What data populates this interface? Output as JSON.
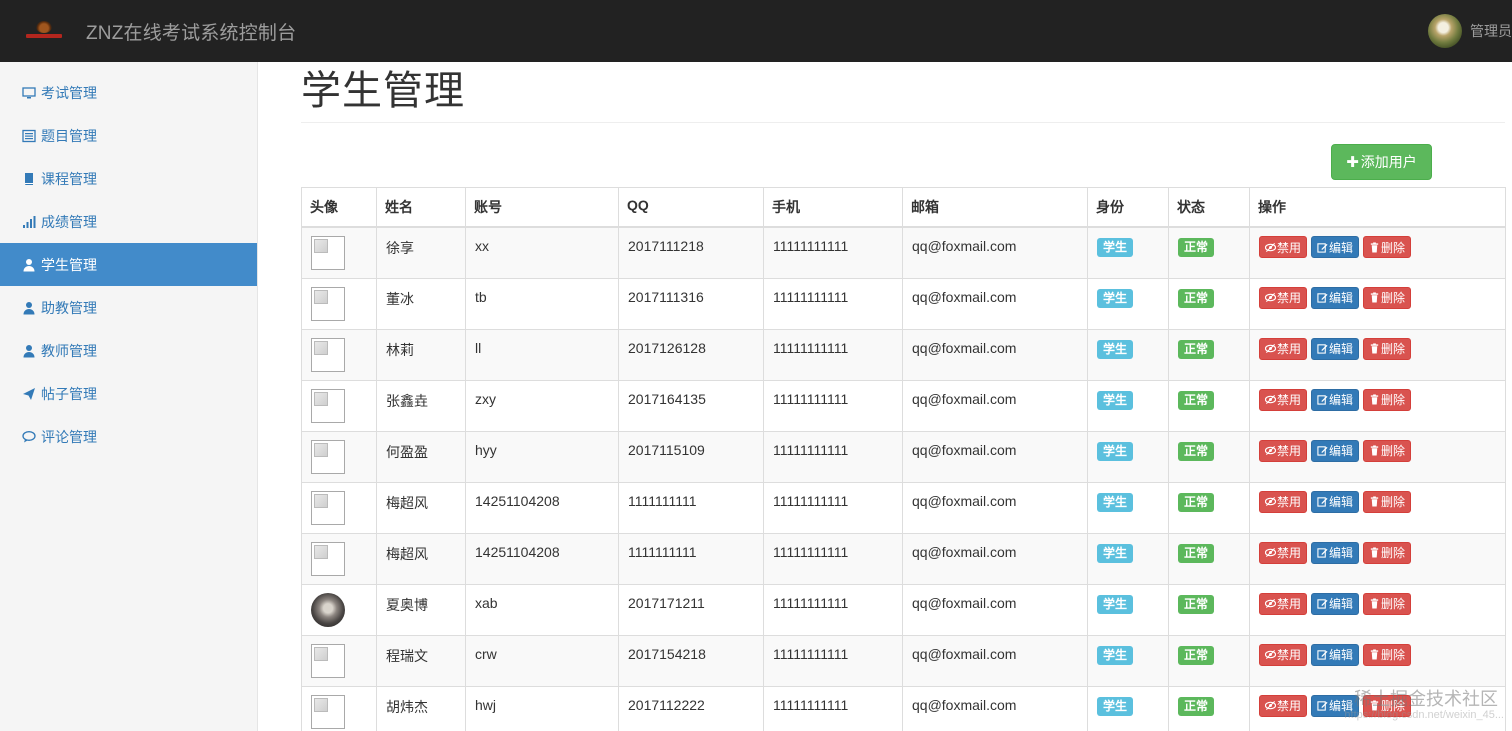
{
  "app": {
    "title": "ZNZ在线考试系统控制台",
    "user": "管理员"
  },
  "sidebar": {
    "items": [
      {
        "label": "考试管理",
        "icon": "monitor-icon"
      },
      {
        "label": "题目管理",
        "icon": "list-icon"
      },
      {
        "label": "课程管理",
        "icon": "book-icon"
      },
      {
        "label": "成绩管理",
        "icon": "signal-icon"
      },
      {
        "label": "学生管理",
        "icon": "user-icon",
        "active": true
      },
      {
        "label": "助教管理",
        "icon": "user-icon"
      },
      {
        "label": "教师管理",
        "icon": "user-icon"
      },
      {
        "label": "帖子管理",
        "icon": "send-icon"
      },
      {
        "label": "评论管理",
        "icon": "comment-icon"
      }
    ]
  },
  "page": {
    "title": "学生管理",
    "add_button": "添加用户"
  },
  "table": {
    "headers": [
      "头像",
      "姓名",
      "账号",
      "QQ",
      "手机",
      "邮箱",
      "身份",
      "状态",
      "操作"
    ],
    "actions": {
      "disable": "禁用",
      "edit": "编辑",
      "delete": "删除"
    },
    "rows": [
      {
        "avatar": "broken-image",
        "name": "徐享",
        "account": "xx",
        "qq": "2017111218",
        "phone": "11111111111",
        "email": "qq@foxmail.com",
        "role": "学生",
        "status": "正常"
      },
      {
        "avatar": "broken-image",
        "name": "董冰",
        "account": "tb",
        "qq": "2017111316",
        "phone": "11111111111",
        "email": "qq@foxmail.com",
        "role": "学生",
        "status": "正常"
      },
      {
        "avatar": "broken-image",
        "name": "林莉",
        "account": "ll",
        "qq": "2017126128",
        "phone": "11111111111",
        "email": "qq@foxmail.com",
        "role": "学生",
        "status": "正常"
      },
      {
        "avatar": "broken-image",
        "name": "张鑫垚",
        "account": "zxy",
        "qq": "2017164135",
        "phone": "11111111111",
        "email": "qq@foxmail.com",
        "role": "学生",
        "status": "正常"
      },
      {
        "avatar": "broken-image",
        "name": "何盈盈",
        "account": "hyy",
        "qq": "2017115109",
        "phone": "11111111111",
        "email": "qq@foxmail.com",
        "role": "学生",
        "status": "正常"
      },
      {
        "avatar": "broken-image",
        "name": "梅超风",
        "account": "14251104208",
        "qq": "1111111111",
        "phone": "11111111111",
        "email": "qq@foxmail.com",
        "role": "学生",
        "status": "正常"
      },
      {
        "avatar": "broken-image",
        "name": "梅超风",
        "account": "14251104208",
        "qq": "1111111111",
        "phone": "11111111111",
        "email": "qq@foxmail.com",
        "role": "学生",
        "status": "正常"
      },
      {
        "avatar": "photo",
        "name": "夏奥博",
        "account": "xab",
        "qq": "2017171211",
        "phone": "11111111111",
        "email": "qq@foxmail.com",
        "role": "学生",
        "status": "正常"
      },
      {
        "avatar": "broken-image",
        "name": "程瑞文",
        "account": "crw",
        "qq": "2017154218",
        "phone": "11111111111",
        "email": "qq@foxmail.com",
        "role": "学生",
        "status": "正常"
      },
      {
        "avatar": "broken-image",
        "name": "胡炜杰",
        "account": "hwj",
        "qq": "2017112222",
        "phone": "11111111111",
        "email": "qq@foxmail.com",
        "role": "学生",
        "status": "正常"
      }
    ]
  },
  "watermark": {
    "text": "稀土掘金技术社区",
    "url": "https://blog.csdn.net/weixin_45..."
  },
  "colors": {
    "navbar": "#222222",
    "sidebar_active": "#428bca",
    "link": "#337ab7",
    "success": "#5cb85c",
    "info": "#5bc0de",
    "danger": "#d9534f",
    "primary": "#337ab7"
  }
}
